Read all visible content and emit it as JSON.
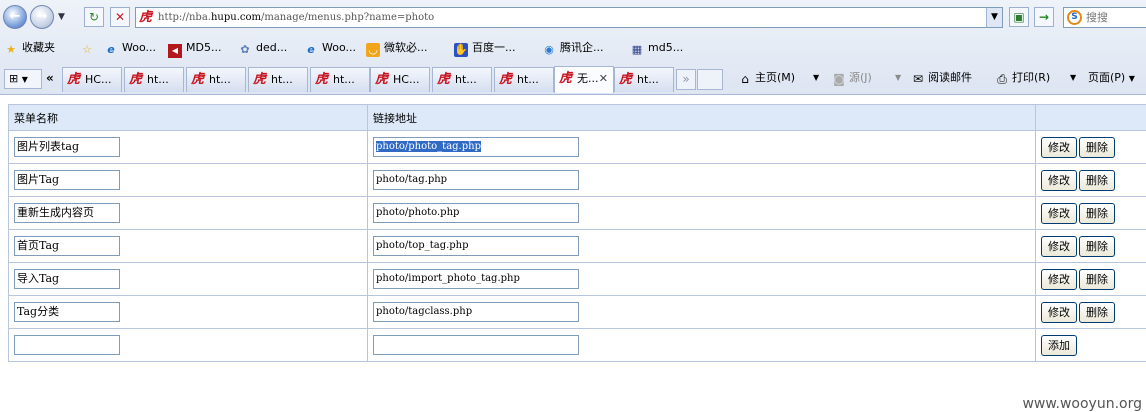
{
  "browser": {
    "url_prefix": "http://nba.",
    "url_domain": "hupu.com",
    "url_path": "/manage/menus.php?name=photo",
    "search_placeholder": "搜搜"
  },
  "favorites": {
    "label": "收藏夹",
    "items": [
      {
        "label": "Woo...",
        "icon": "ie-icon"
      },
      {
        "label": "MD5...",
        "icon": "md5-icon"
      },
      {
        "label": "ded...",
        "icon": "dede-icon"
      },
      {
        "label": "Woo...",
        "icon": "ie-icon"
      },
      {
        "label": "微软必...",
        "icon": "msn-icon"
      },
      {
        "label": "百度一...",
        "icon": "baidu-icon"
      },
      {
        "label": "腾讯企...",
        "icon": "tencent-icon"
      },
      {
        "label": "md5...",
        "icon": "grid-icon"
      }
    ]
  },
  "tabs": [
    {
      "label": "HC..."
    },
    {
      "label": "ht..."
    },
    {
      "label": "ht..."
    },
    {
      "label": "ht..."
    },
    {
      "label": "ht..."
    },
    {
      "label": "HC..."
    },
    {
      "label": "ht..."
    },
    {
      "label": "ht..."
    },
    {
      "label": "无..."
    },
    {
      "label": "ht..."
    }
  ],
  "toolbar": {
    "home": "主页(M)",
    "feeds": "源(J)",
    "read_mail": "阅读邮件",
    "print": "打印(R)",
    "page": "页面(P)"
  },
  "table": {
    "col_name": "菜单名称",
    "col_link": "链接地址",
    "edit_label": "修改",
    "delete_label": "删除",
    "add_label": "添加",
    "rows": [
      {
        "name": "图片列表tag",
        "link": "photo/photo_tag.php"
      },
      {
        "name": "图片Tag",
        "link": "photo/tag.php"
      },
      {
        "name": "重新生成内容页",
        "link": "photo/photo.php"
      },
      {
        "name": "首页Tag",
        "link": "photo/top_tag.php"
      },
      {
        "name": "导入Tag",
        "link": "photo/import_photo_tag.php"
      },
      {
        "name": "Tag分类",
        "link": "photo/tagclass.php"
      }
    ]
  },
  "watermark": "www.wooyun.org"
}
